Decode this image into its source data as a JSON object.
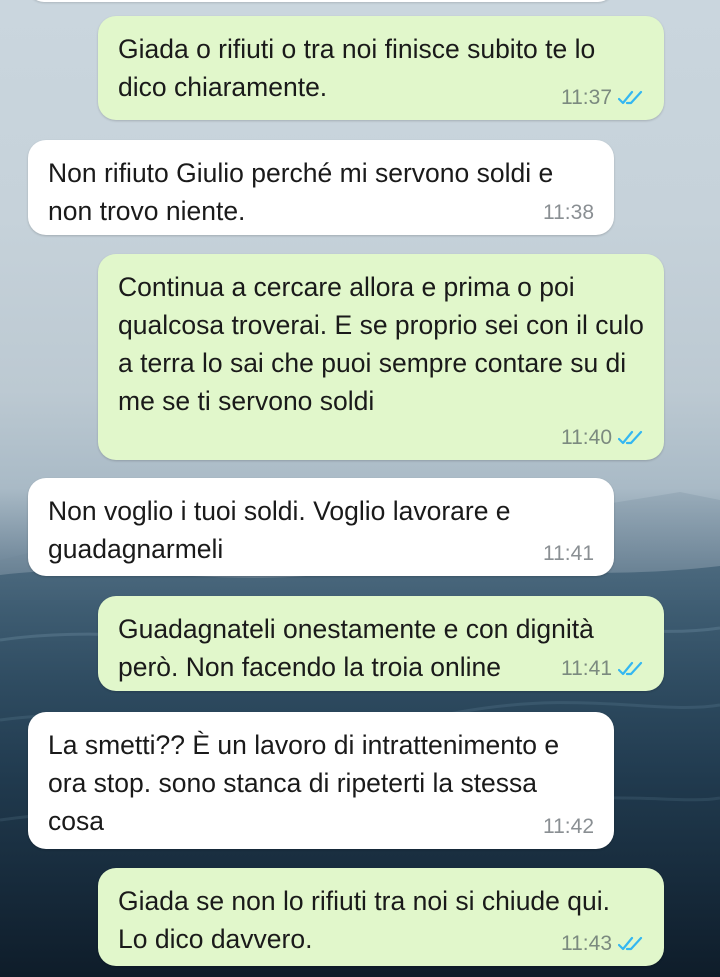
{
  "conversation": {
    "messages": [
      {
        "direction": "out",
        "text": "Giada o rifiuti o tra noi finisce subito te lo dico chiaramente.",
        "time": "11:37",
        "status_icon": "double-check-read-icon"
      },
      {
        "direction": "in",
        "text": "Non rifiuto Giulio perché mi servono soldi e non trovo niente.",
        "time": "11:38"
      },
      {
        "direction": "out",
        "text": "Continua a cercare allora e prima o poi qualcosa troverai. E se proprio sei con il culo a terra lo sai che puoi sempre contare su di me se ti servono soldi",
        "time": "11:40",
        "status_icon": "double-check-read-icon"
      },
      {
        "direction": "in",
        "text": "Non voglio i tuoi soldi. Voglio lavorare e guadagnarmeli",
        "time": "11:41"
      },
      {
        "direction": "out",
        "text": "Guadagnateli onestamente e con dignità però. Non facendo la troia online",
        "time": "11:41",
        "status_icon": "double-check-read-icon"
      },
      {
        "direction": "in",
        "text": "La smetti?? È un lavoro di intrattenimento e ora stop. sono stanca di ripeterti la stessa cosa",
        "time": "11:42"
      },
      {
        "direction": "out",
        "text": "Giada se non lo rifiuti tra noi si chiude qui. Lo dico davvero.",
        "time": "11:43",
        "status_icon": "double-check-read-icon"
      }
    ]
  },
  "colors": {
    "outgoing_bubble": "#e1f7cb",
    "incoming_bubble": "#ffffff",
    "read_ticks": "#34b7f1",
    "background_sky": "#c6d2da",
    "background_sea": "#1e3547"
  }
}
